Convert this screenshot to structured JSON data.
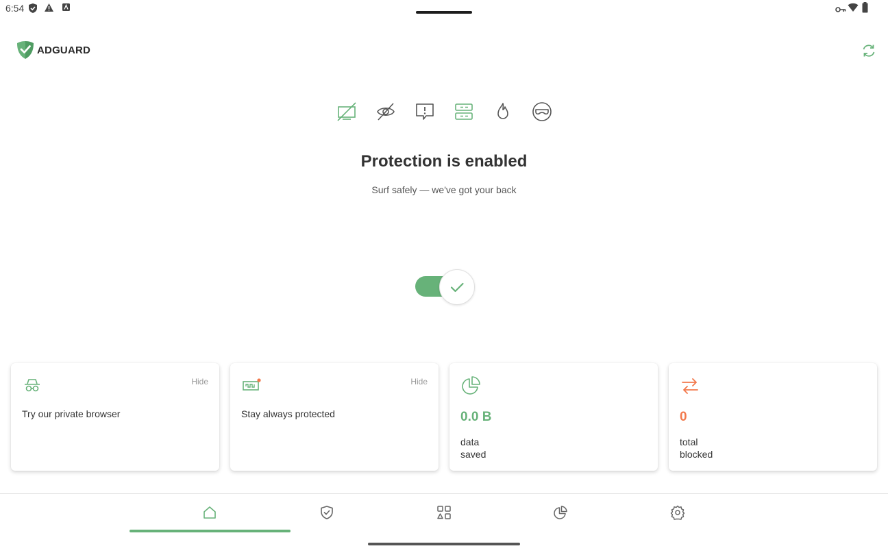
{
  "status_bar": {
    "time": "6:54"
  },
  "header": {
    "brand": "ADGUARD"
  },
  "protection": {
    "title": "Protection is enabled",
    "subtitle": "Surf safely — we've got your back"
  },
  "cards": [
    {
      "text": "Try our private browser",
      "hide": "Hide"
    },
    {
      "text": "Stay always protected",
      "hide": "Hide"
    },
    {
      "value": "0.0 B",
      "label_line1": "data",
      "label_line2": "saved"
    },
    {
      "value": "0",
      "label_line1": "total",
      "label_line2": "blocked"
    }
  ],
  "colors": {
    "accent": "#67b279",
    "warning": "#f2784b",
    "muted": "#777777"
  },
  "nav": {
    "active": "home"
  }
}
